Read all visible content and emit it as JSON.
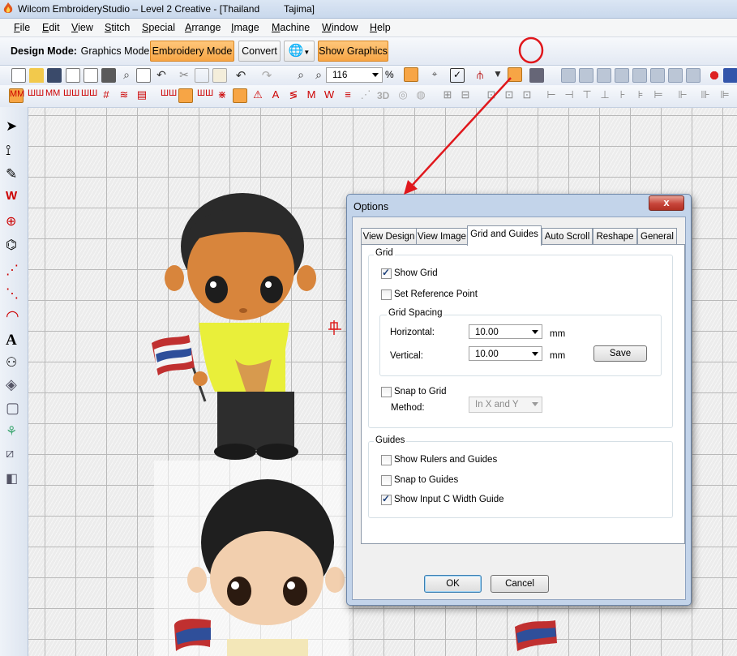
{
  "window": {
    "title": "Wilcom EmbroideryStudio – Level 2 Creative - [Thailand",
    "subtitle": "Tajima]"
  },
  "menu": [
    "File",
    "Edit",
    "View",
    "Stitch",
    "Special",
    "Arrange",
    "Image",
    "Machine",
    "Window",
    "Help"
  ],
  "toolbar": {
    "design_mode_label": "Design Mode:",
    "graphics_mode": "Graphics Mode",
    "embroidery_mode": "Embroidery Mode",
    "convert": "Convert",
    "show_graphics": "Show Graphics",
    "zoom_value": "116",
    "zoom_unit": "%",
    "label_3d": "3D"
  },
  "dialog": {
    "title": "Options",
    "close": "x",
    "tabs": [
      "View Design",
      "View Image",
      "Grid and Guides",
      "Auto Scroll",
      "Reshape",
      "General"
    ],
    "active_tab": "Grid and Guides",
    "grid": {
      "label": "Grid",
      "show_grid": {
        "label": "Show Grid",
        "checked": true
      },
      "set_reference_point": {
        "label": "Set Reference Point",
        "checked": false
      },
      "spacing": {
        "label": "Grid Spacing",
        "horizontal_label": "Horizontal:",
        "horizontal_value": "10.00",
        "vertical_label": "Vertical:",
        "vertical_value": "10.00",
        "unit": "mm",
        "save": "Save"
      },
      "snap_to_grid": {
        "label": "Snap to Grid",
        "checked": false
      },
      "method_label": "Method:",
      "method_value": "In X and Y"
    },
    "guides": {
      "label": "Guides",
      "show_rulers": {
        "label": "Show Rulers and Guides",
        "checked": false
      },
      "snap_to_guides": {
        "label": "Snap to Guides",
        "checked": false
      },
      "show_input_c": {
        "label": "Show Input C Width Guide",
        "checked": true
      }
    },
    "ok": "OK",
    "cancel": "Cancel"
  },
  "colors": {
    "accent_orange": "#f7a545",
    "annotation_red": "#e0171c",
    "dialog_frame": "#c3d4ea"
  }
}
